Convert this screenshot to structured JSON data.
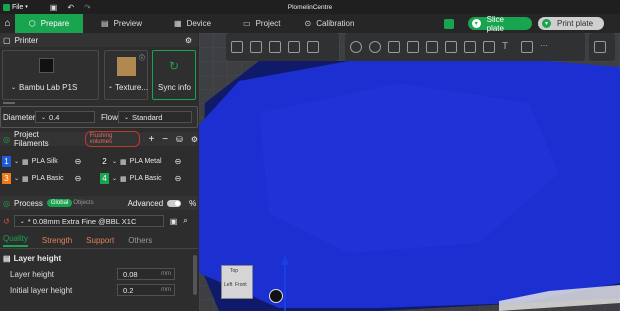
{
  "window": {
    "title": "PlomelinCentre",
    "file_menu": "File"
  },
  "tabs": [
    {
      "label": "Prepare",
      "active": true
    },
    {
      "label": "Preview"
    },
    {
      "label": "Device"
    },
    {
      "label": "Project"
    },
    {
      "label": "Calibration"
    }
  ],
  "actions": {
    "slice": "Slice plate",
    "print": "Print plate"
  },
  "printer": {
    "section_label": "Printer",
    "printer_name": "Bambu Lab P1S",
    "plate_name": "Texture...",
    "sync_label": "Sync info",
    "diameter_label": "Diameter",
    "diameter_value": "0.4",
    "flow_label": "Flow",
    "flow_value": "Standard"
  },
  "filaments": {
    "section_label": "Project Filaments",
    "flushing_label": "Flushing volumes",
    "items": [
      {
        "num": "1",
        "name": "PLA Silk",
        "color": "#1e5bd6"
      },
      {
        "num": "2",
        "name": "PLA Metal",
        "color": "#2a2a2a"
      },
      {
        "num": "3",
        "name": "PLA Basic",
        "color": "#f07a1a"
      },
      {
        "num": "4",
        "name": "PLA Basic",
        "color": "#19a44f"
      }
    ]
  },
  "process": {
    "section_label": "Process",
    "global_label": "Global",
    "objects_label": "Objects",
    "advanced_label": "Advanced",
    "preset": "* 0.08mm Extra Fine @BBL X1C",
    "tabs": [
      "Quality",
      "Strength",
      "Support",
      "Others"
    ],
    "group_label": "Layer height",
    "layer_height_label": "Layer height",
    "layer_height_value": "0.08",
    "initial_layer_label": "Initial layer height",
    "initial_layer_value": "0.2",
    "unit": "mm"
  },
  "viewport": {
    "cube_top": "Top",
    "cube_front": "Front",
    "cube_left": "Left",
    "model_color": "#1c2fd0"
  },
  "colors": {
    "accent": "#19a44f",
    "bg": "#2b2b2b"
  }
}
